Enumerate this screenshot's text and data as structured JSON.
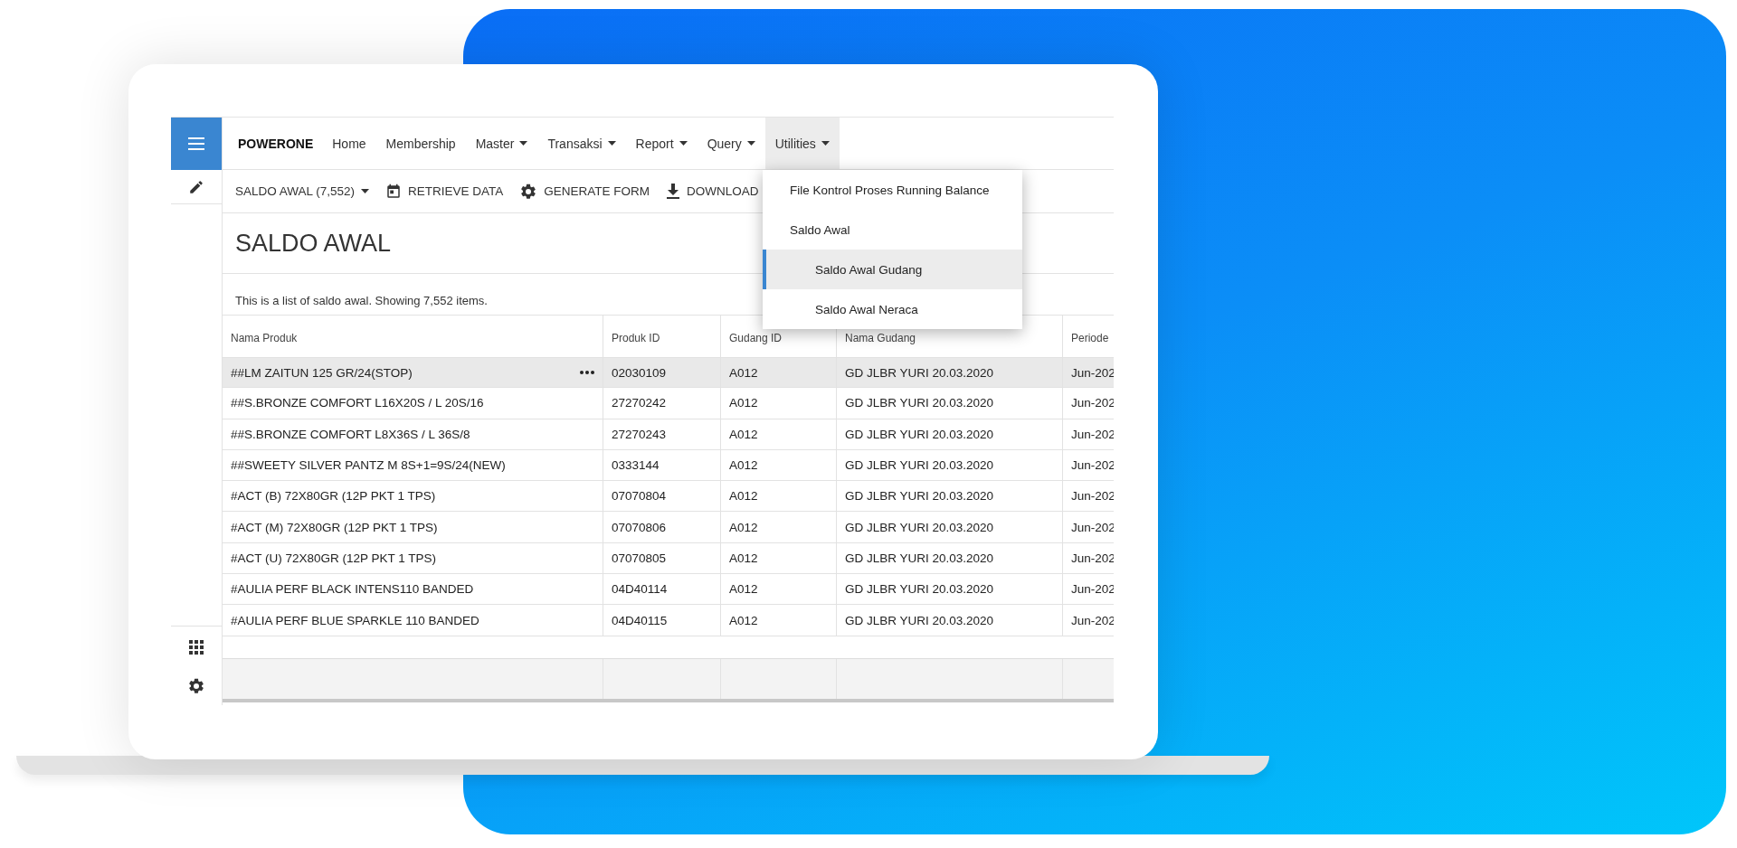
{
  "nav": {
    "brand": "POWERONE",
    "items": [
      {
        "label": "Home",
        "dropdown": false,
        "selected": false
      },
      {
        "label": "Membership",
        "dropdown": false,
        "selected": false
      },
      {
        "label": "Master",
        "dropdown": true,
        "selected": false
      },
      {
        "label": "Transaksi",
        "dropdown": true,
        "selected": false
      },
      {
        "label": "Report",
        "dropdown": true,
        "selected": false
      },
      {
        "label": "Query",
        "dropdown": true,
        "selected": false
      },
      {
        "label": "Utilities",
        "dropdown": true,
        "selected": true
      }
    ]
  },
  "utilities_menu": {
    "items": [
      {
        "label": "File Kontrol Proses Running Balance",
        "selected": false
      },
      {
        "label": "Saldo Awal",
        "selected": false,
        "children": [
          {
            "label": "Saldo Awal Gudang",
            "selected": true
          },
          {
            "label": "Saldo Awal Neraca",
            "selected": false
          }
        ]
      }
    ]
  },
  "toolbar": {
    "items": [
      {
        "label": "SALDO AWAL (7,552)",
        "kind": "dropdown"
      },
      {
        "label": "RETRIEVE DATA",
        "kind": "calendar"
      },
      {
        "label": "GENERATE FORM",
        "kind": "gear"
      },
      {
        "label": "DOWNLOAD",
        "kind": "download"
      }
    ]
  },
  "page": {
    "title": "SALDO AWAL",
    "description": "This is a list of saldo awal. Showing 7,552 items."
  },
  "table": {
    "columns": [
      "Nama Produk",
      "Produk ID",
      "Gudang ID",
      "Nama Gudang",
      "Periode"
    ],
    "rows": [
      {
        "cells": [
          "##LM ZAITUN 125 GR/24(STOP)",
          "02030109",
          "A012",
          "GD JLBR YURI 20.03.2020",
          "Jun-202"
        ],
        "selected": true
      },
      {
        "cells": [
          "##S.BRONZE COMFORT L16X20S / L 20S/16",
          "27270242",
          "A012",
          "GD JLBR YURI 20.03.2020",
          "Jun-202"
        ],
        "selected": false
      },
      {
        "cells": [
          "##S.BRONZE COMFORT L8X36S / L 36S/8",
          "27270243",
          "A012",
          "GD JLBR YURI 20.03.2020",
          "Jun-202"
        ],
        "selected": false
      },
      {
        "cells": [
          "##SWEETY SILVER PANTZ M 8S+1=9S/24(NEW)",
          "0333144",
          "A012",
          "GD JLBR YURI 20.03.2020",
          "Jun-202"
        ],
        "selected": false
      },
      {
        "cells": [
          "#ACT (B) 72X80GR (12P PKT 1 TPS)",
          "07070804",
          "A012",
          "GD JLBR YURI 20.03.2020",
          "Jun-202"
        ],
        "selected": false
      },
      {
        "cells": [
          "#ACT (M) 72X80GR (12P PKT 1 TPS)",
          "07070806",
          "A012",
          "GD JLBR YURI 20.03.2020",
          "Jun-202"
        ],
        "selected": false
      },
      {
        "cells": [
          "#ACT (U) 72X80GR (12P PKT 1 TPS)",
          "07070805",
          "A012",
          "GD JLBR YURI 20.03.2020",
          "Jun-202"
        ],
        "selected": false
      },
      {
        "cells": [
          "#AULIA PERF BLACK INTENS110 BANDED",
          "04D40114",
          "A012",
          "GD JLBR YURI 20.03.2020",
          "Jun-202"
        ],
        "selected": false
      },
      {
        "cells": [
          "#AULIA PERF BLUE SPARKLE 110 BANDED",
          "04D40115",
          "A012",
          "GD JLBR YURI 20.03.2020",
          "Jun-202"
        ],
        "selected": false
      }
    ]
  }
}
